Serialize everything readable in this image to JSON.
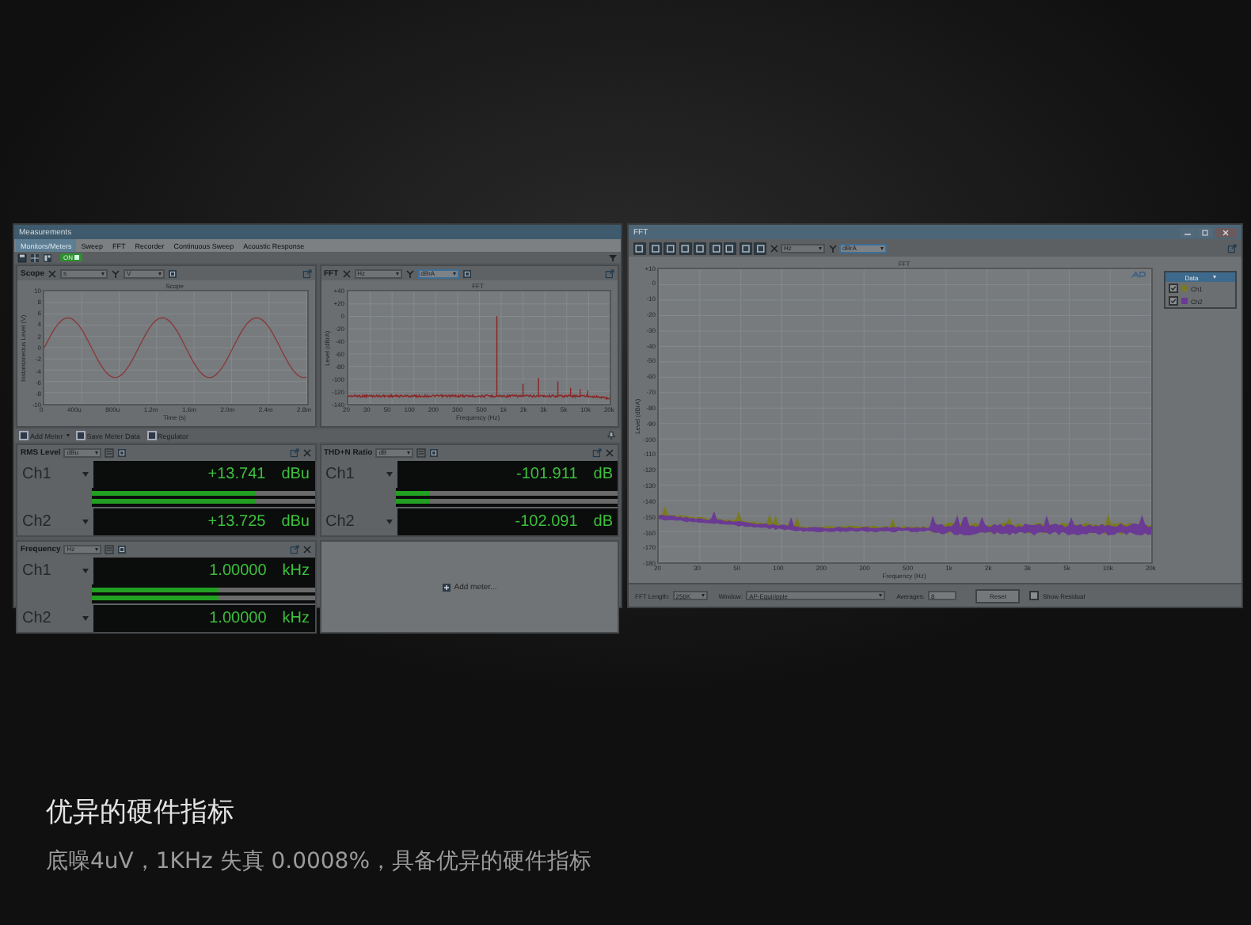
{
  "left_window": {
    "title": "Measurements",
    "tabs": [
      {
        "label": "Monitors/Meters",
        "selected": true
      },
      {
        "label": "Sweep",
        "selected": false
      },
      {
        "label": "FFT",
        "selected": false
      },
      {
        "label": "Recorder",
        "selected": false
      },
      {
        "label": "Continuous Sweep",
        "selected": false
      },
      {
        "label": "Acoustic Response",
        "selected": false
      }
    ],
    "toolbar": {
      "toggle": {
        "label": "ON",
        "on": true
      }
    },
    "panes": [
      {
        "title": "Scope",
        "x_unit": "s",
        "y_unit": "V",
        "plot": {
          "kind": "waveform",
          "chart_title": "Scope",
          "ylabel": "Instantaneous Level (V)",
          "xlabel": "Time (s)",
          "yticks": [
            "10",
            "8",
            "6",
            "4",
            "2",
            "0",
            "-2",
            "-4",
            "-6",
            "-8",
            "-10"
          ],
          "xticks": [
            "0",
            "400u",
            "800u",
            "1.2m",
            "1.6m",
            "2.0m",
            "2.4m",
            "2.8m"
          ]
        }
      },
      {
        "title": "FFT",
        "x_unit": "Hz",
        "y_unit": "dBrA",
        "plot": {
          "kind": "spectrum",
          "chart_title": "FFT",
          "ylabel": "Level (dBrA)",
          "xlabel": "Frequency (Hz)",
          "yticks": [
            "+40",
            "+20",
            "0",
            "-20",
            "-40",
            "-60",
            "-80",
            "-100",
            "-120",
            "-140"
          ],
          "xticks": [
            "20",
            "30",
            "50",
            "100",
            "200",
            "300",
            "500",
            "1k",
            "2k",
            "3k",
            "5k",
            "10k",
            "20k"
          ]
        }
      }
    ],
    "meter_toolbar": [
      "Add Meter",
      "Save Meter Data",
      "Regulator"
    ],
    "meters": [
      {
        "title": "RMS Level",
        "unit_select": "dBu",
        "channels": [
          {
            "name": "Ch1",
            "reading": "+13.741",
            "unit": "dBu",
            "level": 0.73
          },
          {
            "name": "Ch2",
            "reading": "+13.725",
            "unit": "dBu",
            "level": 0.73
          }
        ]
      },
      {
        "title": "THD+N Ratio",
        "unit_select": "dB",
        "channels": [
          {
            "name": "Ch1",
            "reading": "-101.911",
            "unit": "dB",
            "level": 0.15
          },
          {
            "name": "Ch2",
            "reading": "-102.091",
            "unit": "dB",
            "level": 0.15
          }
        ]
      },
      {
        "title": "Frequency",
        "unit_select": "Hz",
        "channels": [
          {
            "name": "Ch1",
            "reading": "1.00000",
            "unit": "kHz",
            "level": 0.57
          },
          {
            "name": "Ch2",
            "reading": "1.00000",
            "unit": "kHz",
            "level": 0.57
          }
        ]
      }
    ],
    "add_meter": "Add meter..."
  },
  "right_window": {
    "title": "FFT",
    "x_unit": "Hz",
    "y_unit": "dBrA",
    "plot": {
      "kind": "spectrum_dual",
      "chart_title": "FFT",
      "ylabel": "Level (dBrA)",
      "xlabel": "Frequency (Hz)",
      "yticks": [
        "+10",
        "0",
        "-10",
        "-20",
        "-30",
        "-40",
        "-50",
        "-60",
        "-70",
        "-80",
        "-90",
        "-100",
        "-110",
        "-120",
        "-130",
        "-140",
        "-150",
        "-160",
        "-170",
        "-180"
      ],
      "xticks": [
        "20",
        "30",
        "50",
        "100",
        "200",
        "300",
        "500",
        "1k",
        "2k",
        "3k",
        "5k",
        "10k",
        "20k"
      ]
    },
    "legend": {
      "title": "Data",
      "items": [
        {
          "name": "Ch1",
          "checked": true,
          "color": "#7a7a22"
        },
        {
          "name": "Ch2",
          "checked": true,
          "color": "#6a3a94"
        }
      ]
    },
    "controls": {
      "fft_length": {
        "label": "FFT Length:",
        "value": "256K"
      },
      "window": {
        "label": "Window:",
        "value": "AP-Equiripple"
      },
      "averages": {
        "label": "Averages:",
        "value": "8"
      },
      "reset": "Reset",
      "show_residual": {
        "label": "Show Residual",
        "checked": false
      }
    }
  },
  "caption": {
    "title": "优异的硬件指标",
    "subtitle": "底噪4uV，1KHz 失真 0.0008%，具备优异的硬件指标"
  }
}
